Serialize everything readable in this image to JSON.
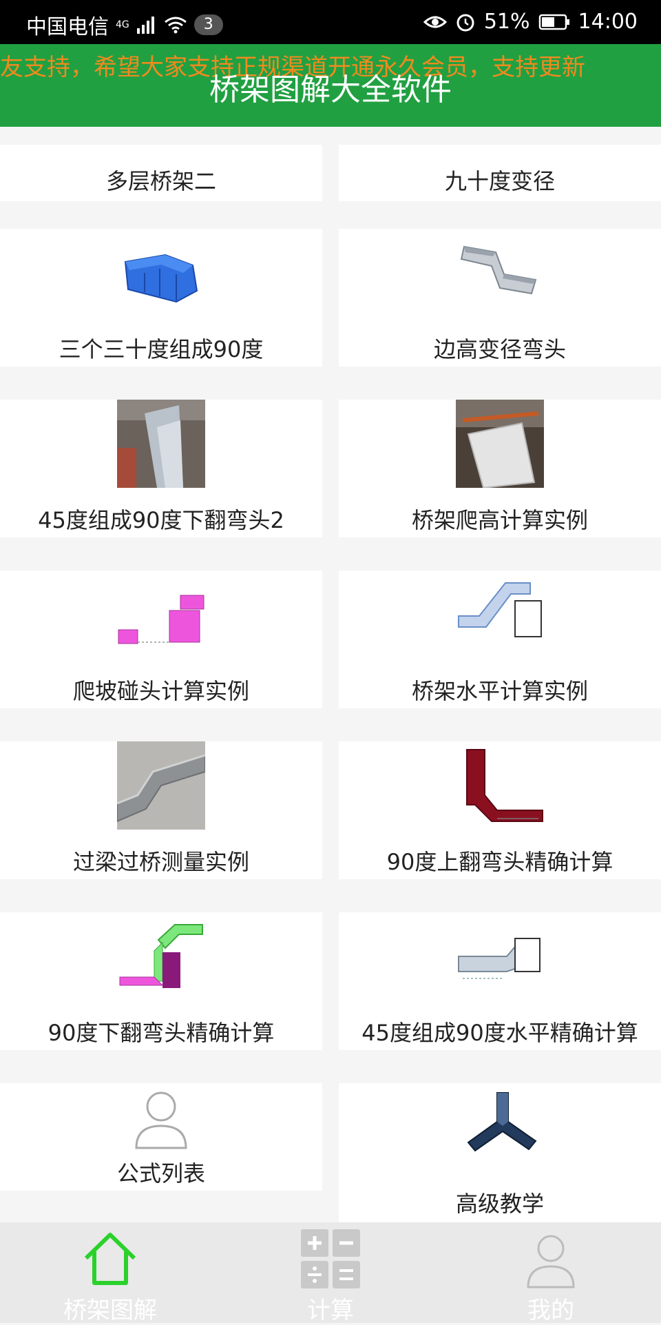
{
  "status": {
    "carrier": "中国电信",
    "network": "4G",
    "notif_count": "3",
    "battery": "51%",
    "time": "14:00"
  },
  "header": {
    "marquee": "友支持，希望大家支持正规渠道开通永久会员，支持更新",
    "title": "桥架图解大全软件"
  },
  "cards": [
    {
      "label": "多层桥架二",
      "icon": "none"
    },
    {
      "label": "九十度变径",
      "icon": "none"
    },
    {
      "label": "三个三十度组成90度",
      "icon": "blue-tray-elbow"
    },
    {
      "label": "边高变径弯头",
      "icon": "gray-offset-tray"
    },
    {
      "label": "45度组成90度下翻弯头2",
      "icon": "photo-tray-down"
    },
    {
      "label": "桥架爬高计算实例",
      "icon": "photo-tray-climb"
    },
    {
      "label": "爬坡碰头计算实例",
      "icon": "pink-slope-diagram"
    },
    {
      "label": "桥架水平计算实例",
      "icon": "blue-horizontal-diagram"
    },
    {
      "label": "过梁过桥测量实例",
      "icon": "photo-beam-crossing"
    },
    {
      "label": "90度上翻弯头精确计算",
      "icon": "red-up-elbow"
    },
    {
      "label": "90度下翻弯头精确计算",
      "icon": "green-purple-down-elbow"
    },
    {
      "label": "45度组成90度水平精确计算",
      "icon": "gray-horizontal-elbow"
    },
    {
      "label": "公式列表",
      "icon": "person-outline"
    },
    {
      "label": "高级教学",
      "icon": "dark-tee-junction"
    }
  ],
  "nav": [
    {
      "label": "桥架图解",
      "icon": "home-icon",
      "active": true
    },
    {
      "label": "计算",
      "icon": "calculator-icon",
      "active": false
    },
    {
      "label": "我的",
      "icon": "profile-icon",
      "active": false
    }
  ],
  "colors": {
    "header": "#21a042",
    "marquee": "#f08a1e",
    "active_nav": "#2bd12b"
  }
}
